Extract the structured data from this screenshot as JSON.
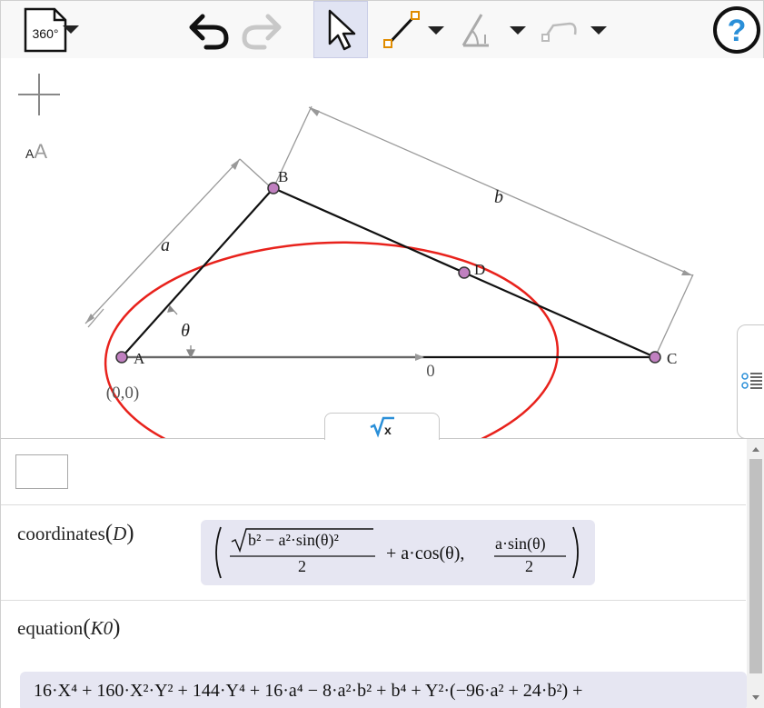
{
  "toolbar": {
    "perspective_label": "360°",
    "tools": [
      "undo",
      "redo",
      "move",
      "segment",
      "angle",
      "polyline"
    ],
    "help_label": "?"
  },
  "graphics": {
    "points": [
      {
        "name": "A",
        "coords_label": "(0,0)"
      },
      {
        "name": "B"
      },
      {
        "name": "C"
      },
      {
        "name": "D"
      }
    ],
    "labels": {
      "side_a": "a",
      "side_b": "b",
      "angle": "θ",
      "zero": "0"
    },
    "curve_color": "#e8221c",
    "point_color": "#c080c0"
  },
  "algebra": {
    "rows": [
      {
        "command": "coordinates",
        "arg": "D",
        "result": {
          "sqrt_inner": "b² − a²·sin(θ)²",
          "denom1": "2",
          "middle": "+ a·cos(θ),",
          "num2": "a·sin(θ)",
          "denom2": "2"
        }
      },
      {
        "command": "equation",
        "arg": "K0",
        "result": "16·X⁴ + 160·X²·Y² + 144·Y⁴ + 16·a⁴ − 8·a²·b² + b⁴ + Y²·(−96·a² + 24·b²) +"
      }
    ]
  }
}
